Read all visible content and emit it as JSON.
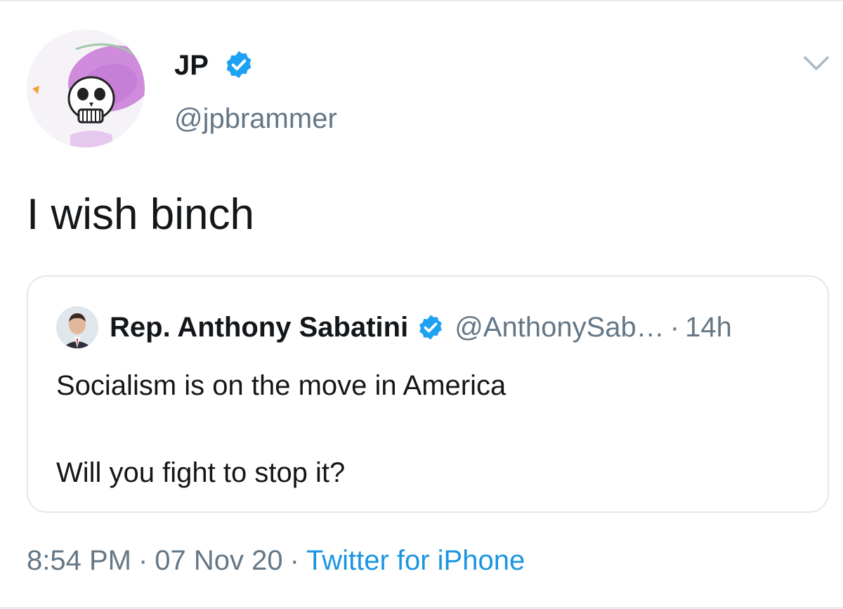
{
  "tweet": {
    "author": {
      "display_name": "JP",
      "handle": "@jpbrammer",
      "verified": true,
      "avatar_icon": "skeleton-sombrero-avatar"
    },
    "text": "I wish binch",
    "menu_icon": "chevron-down-icon",
    "quoted_tweet": {
      "author": {
        "display_name": "Rep. Anthony Sabatini",
        "handle": "@AnthonySab…",
        "verified": true,
        "avatar_icon": "profile-photo"
      },
      "separator": "·",
      "time": "14h",
      "line1": "Socialism is on the move in America",
      "line2": "Will you fight to stop it?"
    },
    "meta": {
      "time": "8:54 PM",
      "separator": "·",
      "date": "07 Nov 20",
      "source": "Twitter for iPhone"
    }
  },
  "colors": {
    "text_primary": "#14171a",
    "text_secondary": "#657786",
    "link_blue": "#1b95e0",
    "verified_blue": "#1da1f2",
    "border": "#e1e8ed"
  }
}
